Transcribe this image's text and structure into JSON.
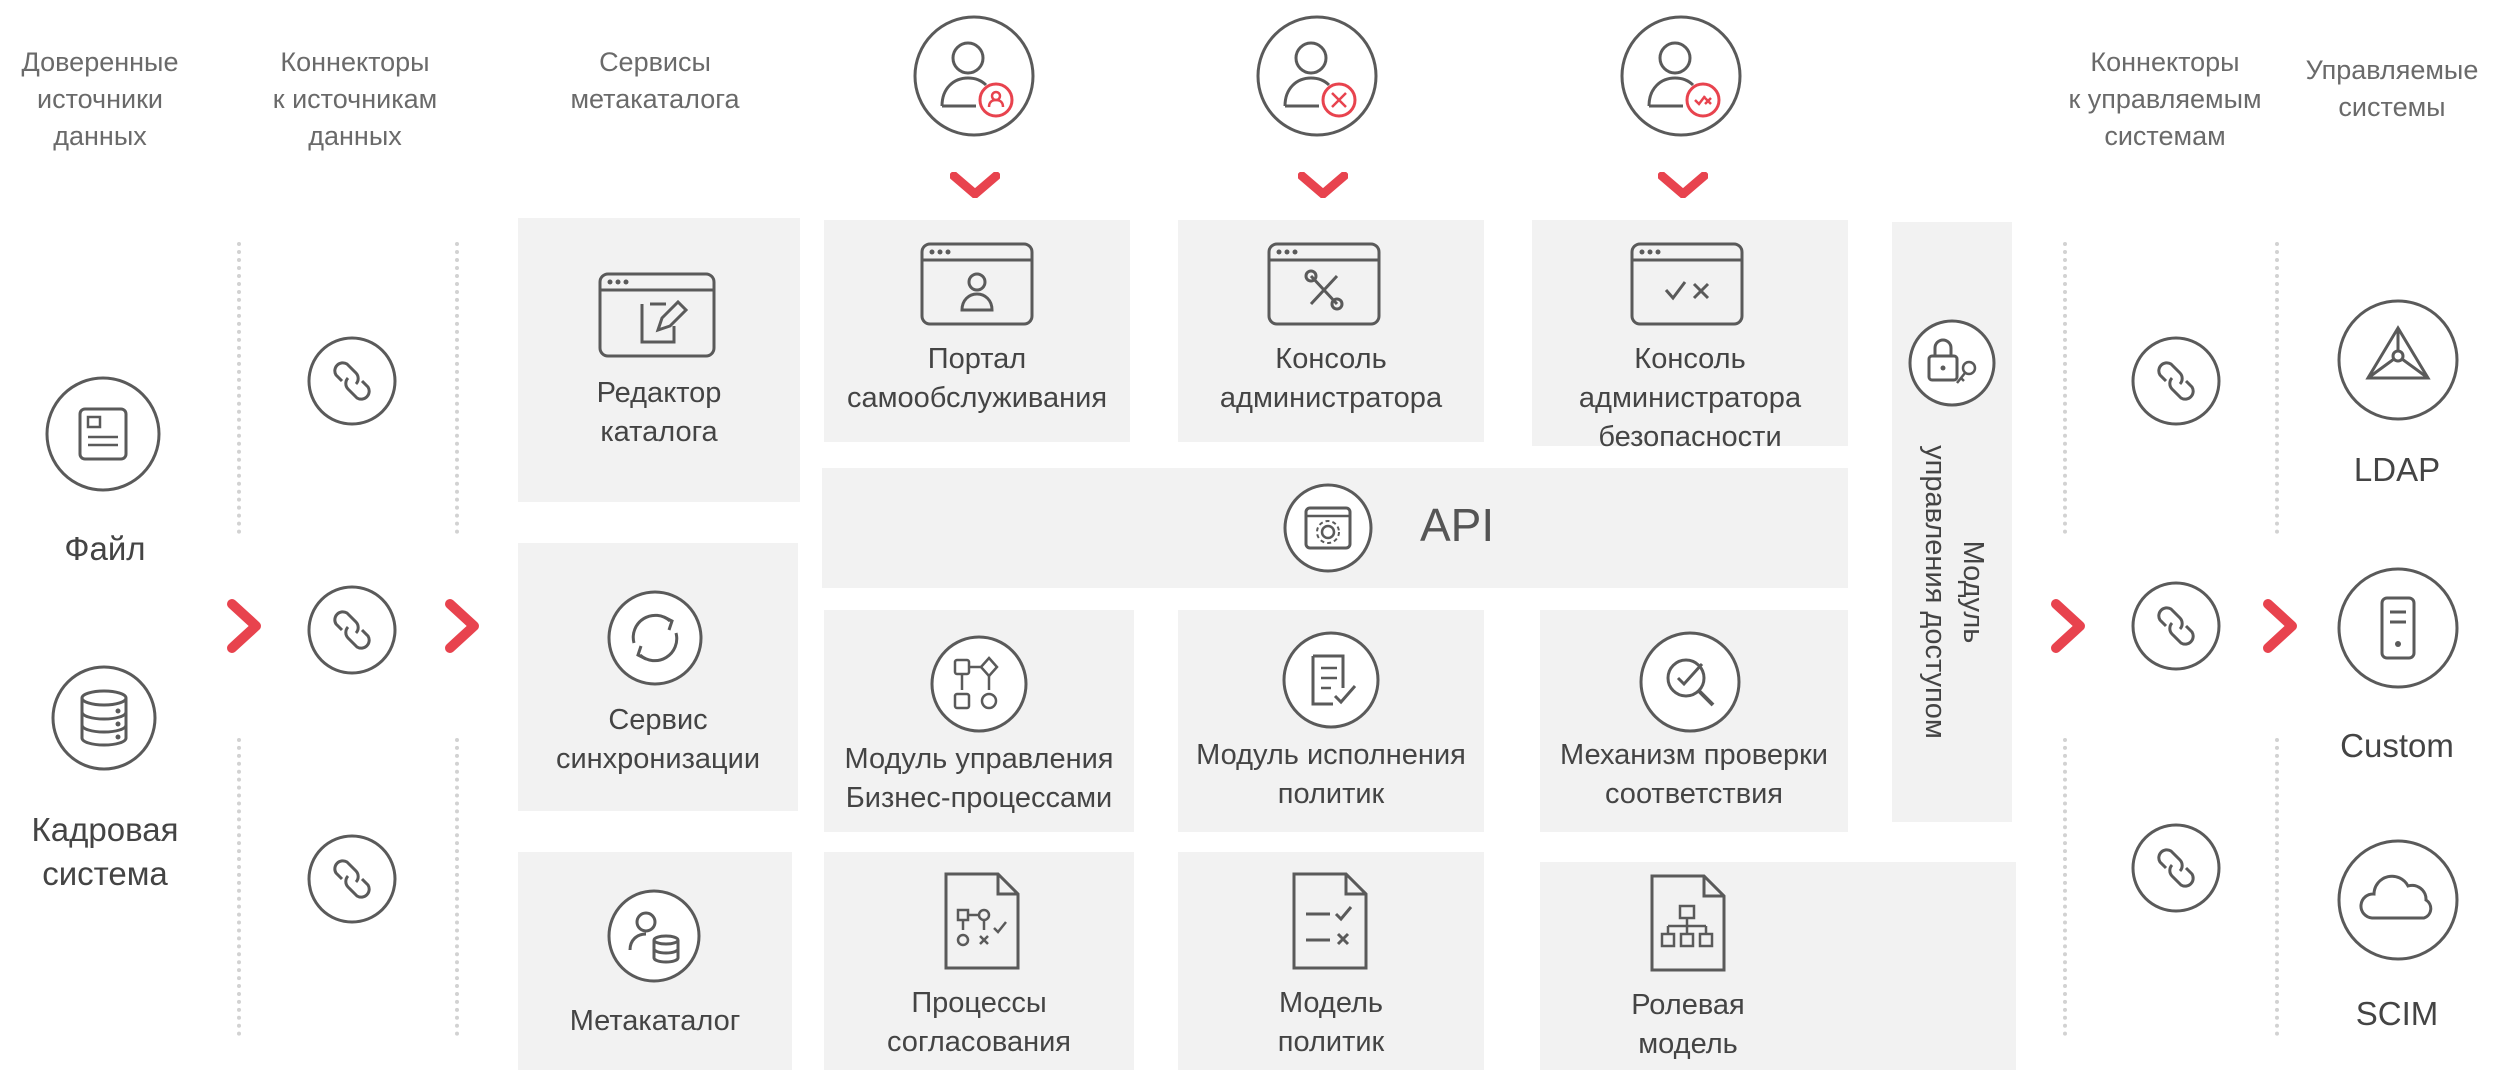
{
  "headers": {
    "trusted_sources": "Доверенные\nисточники\nданных",
    "source_connectors": "Коннекторы\nк источникам\nданных",
    "metacatalog_services": "Сервисы\nметакаталога",
    "target_connectors": "Коннекторы\nк управляемым\nсистемам",
    "managed_systems": "Управляемые\nсистемы"
  },
  "sources": {
    "file": "Файл",
    "hr": "Кадровая\nсистема"
  },
  "services": {
    "catalog_editor": "Редактор\nкаталога",
    "sync_service": "Сервис\nсинхронизации",
    "metacatalog": "Метакаталог"
  },
  "consoles": {
    "self_service": "Портал\nсамообслуживания",
    "admin_console": "Консоль\nадминистратора",
    "security_console": "Консоль\nадминистратора\nбезопасности"
  },
  "api": "API",
  "modules": {
    "bpm": "Модуль управления\nБизнес-процессами",
    "policy_exec": "Модуль исполнения\nполитик",
    "compliance": "Механизм проверки\nсоответствия"
  },
  "models": {
    "approval": "Процессы\nсогласования",
    "policy_model": "Модель\nполитик",
    "role_model": "Ролевая\nмодель"
  },
  "access_module": "Модуль\nуправления доступом",
  "targets": {
    "ldap": "LDAP",
    "custom": "Custom",
    "scim": "SCIM"
  },
  "colors": {
    "accent": "#e8434e",
    "icon_stroke": "#5a5a5a",
    "box_bg": "#f2f2f2",
    "dotted": "#d2d2d2"
  }
}
